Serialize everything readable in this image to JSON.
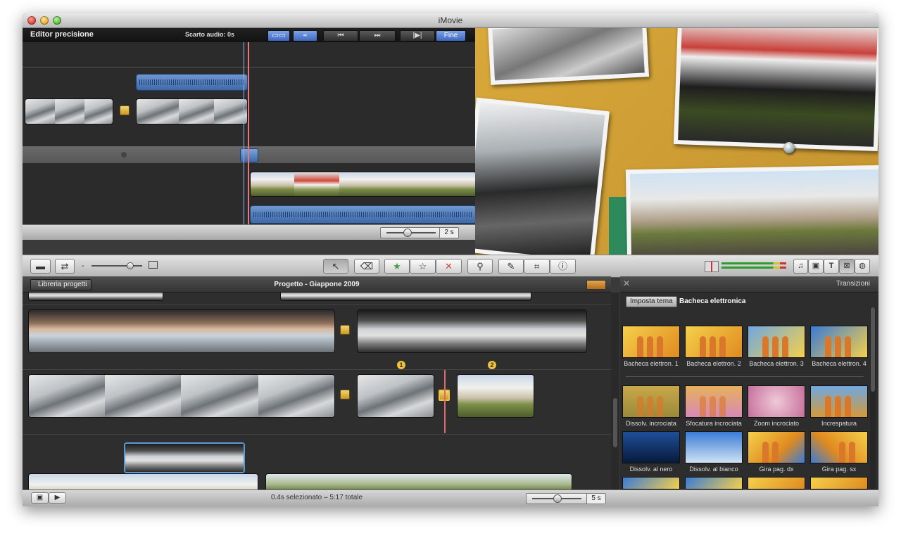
{
  "window": {
    "title": "iMovie"
  },
  "precision_editor": {
    "title": "Editor precisione",
    "audio_offset": "Scarto audio: 0s",
    "done_label": "Fine",
    "zoom_value": "2 s"
  },
  "project": {
    "back_label": "Libreria progetti",
    "title": "Progetto - Giappone 2009",
    "marker_1": "1",
    "marker_2": "2"
  },
  "status": {
    "selection_text": "0.4s selezionato – 5:17 totale",
    "zoom_value": "5 s"
  },
  "transitions": {
    "title": "Transizioni",
    "theme_button": "Imposta tema",
    "theme_value": "Bacheca elettronica",
    "items": [
      {
        "label": "Bacheca elettron. 1"
      },
      {
        "label": "Bacheca elettron. 2"
      },
      {
        "label": "Bacheca elettron. 3"
      },
      {
        "label": "Bacheca elettron. 4"
      },
      {
        "label": "Dissolv. incrociata"
      },
      {
        "label": "Sfocatura incrociata"
      },
      {
        "label": "Zoom incrociato"
      },
      {
        "label": "Increspatura"
      },
      {
        "label": "Dissolv. al nero"
      },
      {
        "label": "Dissolv. al bianco"
      },
      {
        "label": "Gira pag. dx"
      },
      {
        "label": "Gira pag. sx"
      }
    ]
  },
  "toolbar_icons": [
    "camera-icon",
    "swap-icon",
    "thumbnail-small-icon",
    "thumbnail-large-icon",
    "arrow-icon",
    "keyword-icon",
    "favorite-icon",
    "unmark-icon",
    "reject-icon",
    "key-icon",
    "microphone-icon",
    "crop-icon",
    "info-icon",
    "music-icon",
    "photo-icon",
    "title-icon",
    "transition-icon",
    "map-icon"
  ]
}
